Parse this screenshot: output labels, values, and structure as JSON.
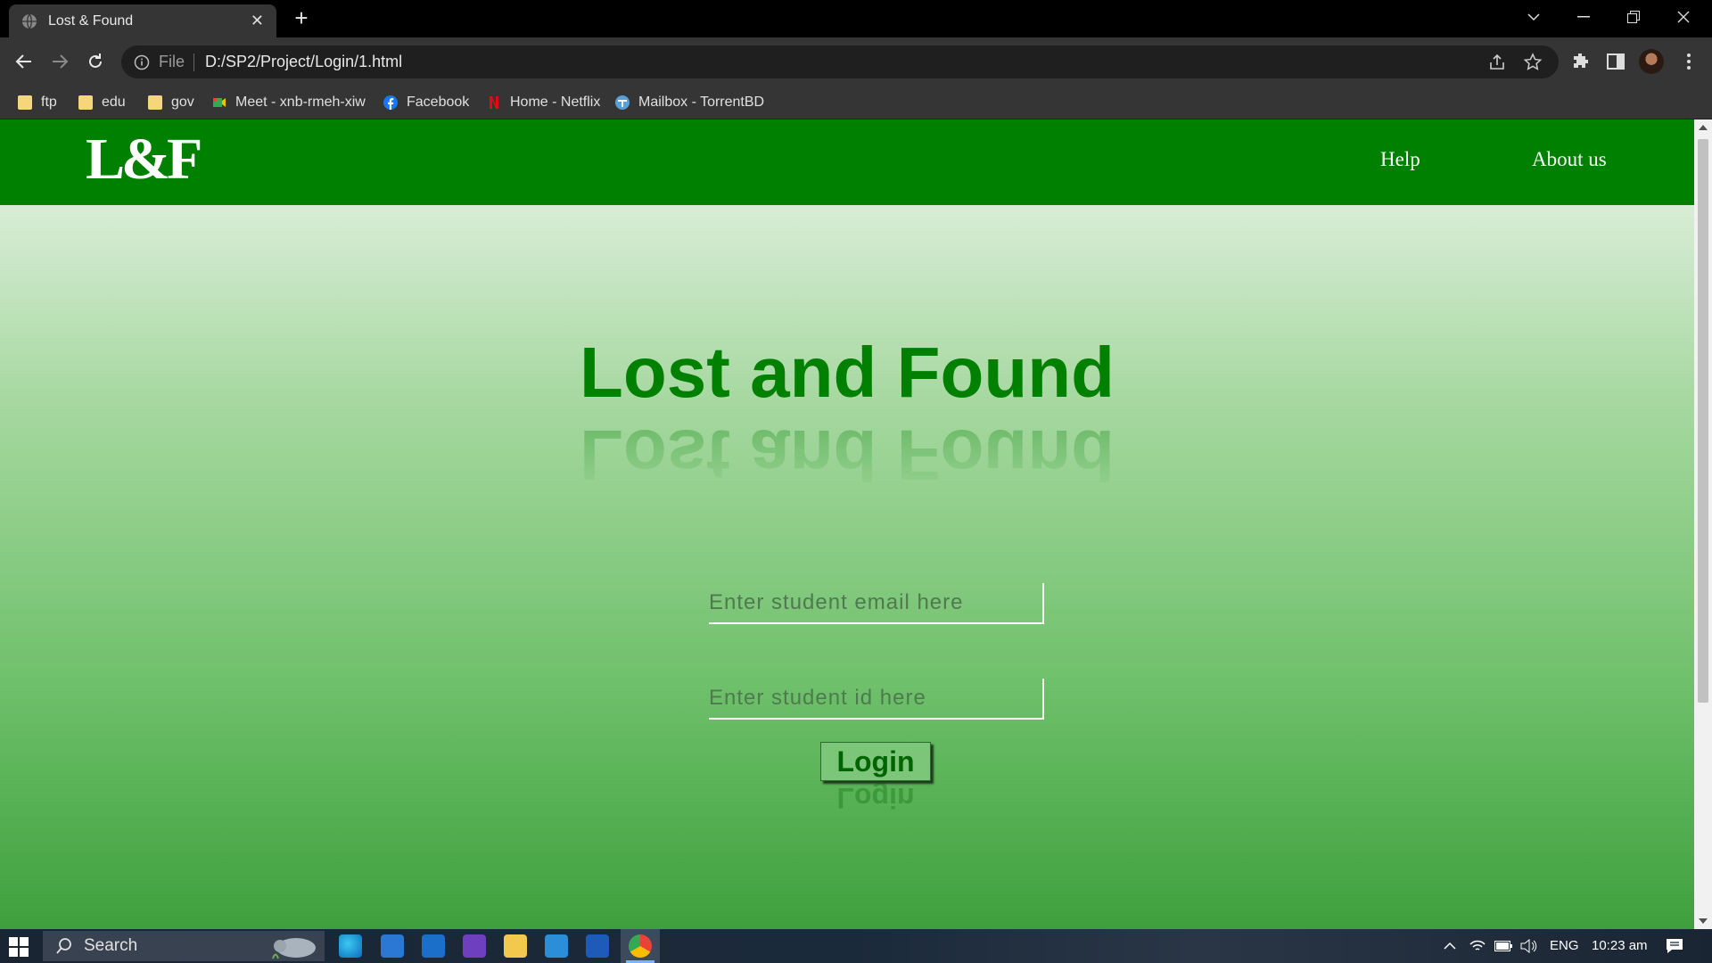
{
  "browser": {
    "tab_title": "Lost & Found",
    "url_scheme_label": "File",
    "url": "D:/SP2/Project/Login/1.html",
    "bookmarks": [
      "ftp",
      "edu",
      "gov",
      "Meet - xnb-rmeh-xiw",
      "Facebook",
      "Home - Netflix",
      "Mailbox - TorrentBD"
    ]
  },
  "site": {
    "logo": "L&F",
    "nav": {
      "help": "Help",
      "about": "About us"
    },
    "heading": "Lost and Found",
    "email_placeholder": "Enter student email here",
    "id_placeholder": "Enter student id here",
    "login_label": "Login"
  },
  "taskbar": {
    "search_label": "Search",
    "language": "ENG",
    "time": "10:23 am"
  },
  "colors": {
    "brand_green": "#008000",
    "header_bg": "#008000"
  }
}
